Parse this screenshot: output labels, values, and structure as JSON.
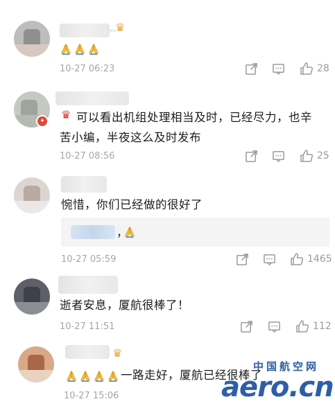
{
  "comments": [
    {
      "text": "",
      "timestamp": "10-27 06:23",
      "likes": "28"
    },
    {
      "text": "可以看出机组处理相当及时，已经尽力，也辛苦小编，半夜这么及时发布",
      "text_line1": "可以看出机组处理相当及时，已经尽力，也辛",
      "text_line2": "苦小编，半夜这么及时发布",
      "timestamp": "10-27 08:56",
      "likes": "25"
    },
    {
      "text": "惋惜，你们已经做的很好了",
      "reply_text": "，",
      "timestamp": "10-27 05:59",
      "likes": "1465"
    },
    {
      "text": "逝者安息，厦航很棒了！",
      "timestamp": "10-27 11:51",
      "likes": "112"
    },
    {
      "text": "一路走好，厦航已经很棒了",
      "timestamp": "10-27 15:06",
      "likes": ""
    }
  ],
  "watermark": {
    "cn": "中国航空网",
    "en": "aero.cn"
  },
  "colors": {
    "text": "#1b1b1b",
    "meta": "#a6a6a6",
    "icon": "#9b9b9b",
    "reply_bg": "#f4f4f4",
    "watermark": "#2d5fa6"
  },
  "icons": [
    "share-icon",
    "comment-icon",
    "thumbs-up-icon",
    "praying-hands-emoji",
    "crown-emoji"
  ]
}
